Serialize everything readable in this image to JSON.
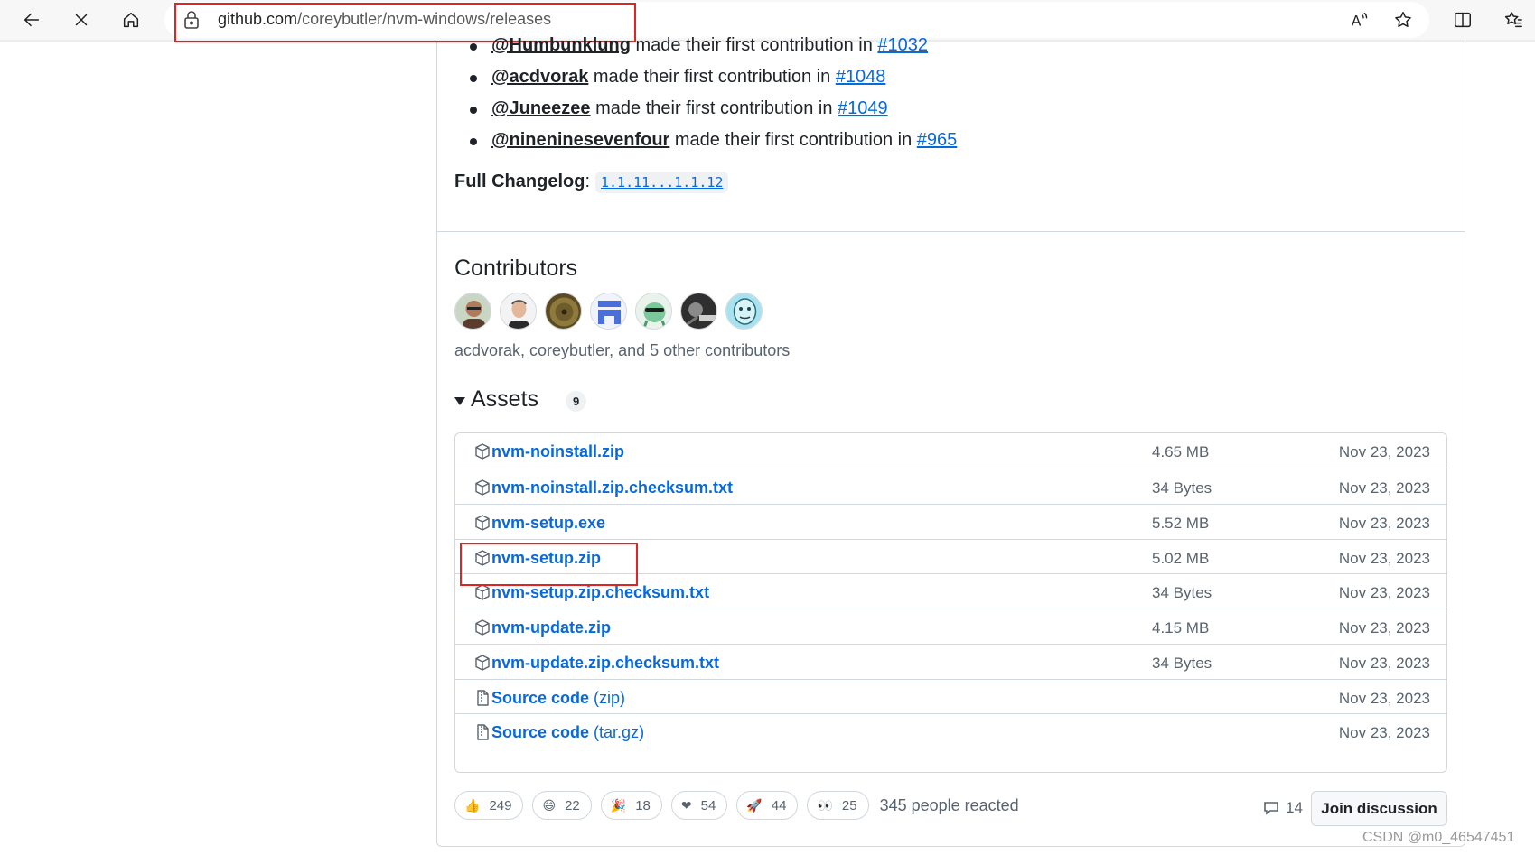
{
  "browser": {
    "url_host": "github.com",
    "url_path": "/coreybutler/nvm-windows/releases",
    "icons": [
      "back-icon",
      "close-icon",
      "home-icon",
      "lock-icon",
      "read-aloud-icon",
      "favorite-star-icon",
      "split-screen-icon",
      "favorites-icon"
    ],
    "read_aloud_glyph": "A"
  },
  "contributions": [
    {
      "user": "@Humbunklung",
      "text": " made their first contribution in ",
      "pr": "#1032"
    },
    {
      "user": "@acdvorak",
      "text": " made their first contribution in ",
      "pr": "#1048"
    },
    {
      "user": "@Juneezee",
      "text": " made their first contribution in ",
      "pr": "#1049"
    },
    {
      "user": "@nineninesevenfour",
      "text": " made their first contribution in ",
      "pr": "#965"
    }
  ],
  "changelog": {
    "label": "Full Changelog",
    "separator": ":",
    "link": "1.1.11...1.1.12"
  },
  "contributors": {
    "heading": "Contributors",
    "summary": "acdvorak, coreybutler, and 5 other contributors",
    "avatar_colors": [
      "#6b4a3a",
      "#e8e8e8",
      "#7a6a3a",
      "#4a6fd8",
      "#b7e0c8",
      "#3a3a3a",
      "#8fd6e6"
    ]
  },
  "assets": {
    "heading": "Assets",
    "count": "9",
    "rows": [
      {
        "name": "nvm-noinstall.zip",
        "ext": "",
        "size": "4.65 MB",
        "date": "Nov 23, 2023",
        "icon": "package-icon"
      },
      {
        "name": "nvm-noinstall.zip.checksum.txt",
        "ext": "",
        "size": "34 Bytes",
        "date": "Nov 23, 2023",
        "icon": "package-icon"
      },
      {
        "name": "nvm-setup.exe",
        "ext": "",
        "size": "5.52 MB",
        "date": "Nov 23, 2023",
        "icon": "package-icon"
      },
      {
        "name": "nvm-setup.zip",
        "ext": "",
        "size": "5.02 MB",
        "date": "Nov 23, 2023",
        "icon": "package-icon"
      },
      {
        "name": "nvm-setup.zip.checksum.txt",
        "ext": "",
        "size": "34 Bytes",
        "date": "Nov 23, 2023",
        "icon": "package-icon"
      },
      {
        "name": "nvm-update.zip",
        "ext": "",
        "size": "4.15 MB",
        "date": "Nov 23, 2023",
        "icon": "package-icon"
      },
      {
        "name": "nvm-update.zip.checksum.txt",
        "ext": "",
        "size": "34 Bytes",
        "date": "Nov 23, 2023",
        "icon": "package-icon"
      },
      {
        "name": "Source code",
        "ext": " (zip)",
        "size": "",
        "date": "Nov 23, 2023",
        "icon": "file-zip-icon"
      },
      {
        "name": "Source code",
        "ext": " (tar.gz)",
        "size": "",
        "date": "Nov 23, 2023",
        "icon": "file-zip-icon"
      }
    ]
  },
  "reactions": [
    {
      "emoji": "👍",
      "count": "249",
      "icon": "thumbs-up-icon"
    },
    {
      "emoji": "😄",
      "count": "22",
      "icon": "laugh-icon"
    },
    {
      "emoji": "🎉",
      "count": "18",
      "icon": "hooray-icon"
    },
    {
      "emoji": "❤",
      "count": "54",
      "icon": "heart-icon"
    },
    {
      "emoji": "🚀",
      "count": "44",
      "icon": "rocket-icon"
    },
    {
      "emoji": "👀",
      "count": "25",
      "icon": "eyes-icon"
    }
  ],
  "reaction_summary": "345 people reacted",
  "comments_count": "14",
  "join_label": "Join discussion",
  "watermark": "CSDN @m0_46547451",
  "colors": {
    "link": "#0969da",
    "highlight": "#e02424",
    "border": "#d0d7de"
  }
}
